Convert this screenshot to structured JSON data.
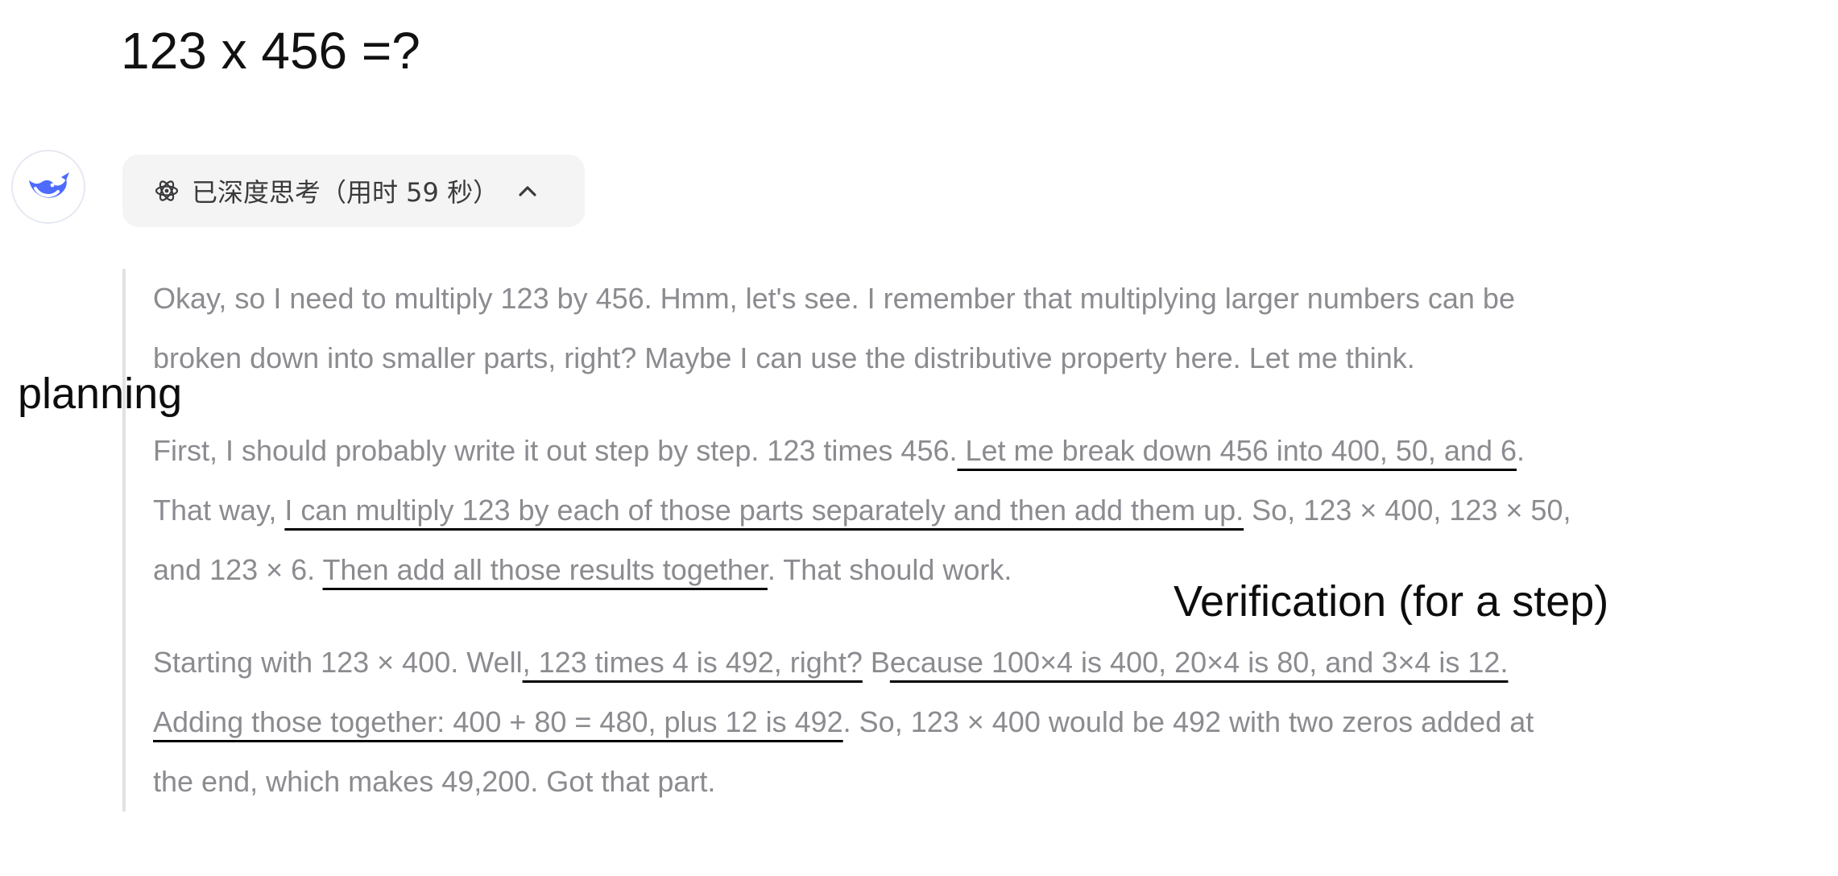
{
  "question": "123 x 456 =?",
  "assistant": {
    "avatar_icon": "deepseek-whale-icon",
    "brand_color": "#4d6bfe"
  },
  "thinking": {
    "icon": "atom-icon",
    "label": "已深度思考（用时 59 秒）",
    "chevron_icon": "chevron-up-icon"
  },
  "reasoning": {
    "p1": {
      "l1": "Okay, so I need to multiply 123 by 456. Hmm, let's see. I remember that multiplying larger numbers can be",
      "l2": "broken down into smaller parts, right? Maybe I can use the distributive property here. Let me think."
    },
    "p2": {
      "l1a": "First, I should probably write it out step by step. 123 times 456.",
      "l1b": " Let me break down 456 into 400, 50, and 6",
      "l1c": ".",
      "l2a": "That way, ",
      "l2b": "I can multiply 123 by each of those parts separately and then add them up.",
      "l2c": " So, 123 × 400, 123 × 50,",
      "l3a": "and 123 × 6. ",
      "l3b": "Then add all those results together",
      "l3c": ". That should work."
    },
    "p3": {
      "l1a": "Starting with 123 × 400. Well",
      "l1b": ", 123 times 4 is 492, right?",
      "l1c": " B",
      "l1d": "ecause 100×4 is 400, 20×4 is 80, and 3×4 is 12.  ",
      "l2a": "Adding those together: 400 + 80 = 480, plus 12 is 492",
      "l2b": ". So, 123 × 400 would be 492 with two zeros added at",
      "l3": "the end, which makes 49,200. Got that part."
    }
  },
  "annotations": {
    "planning": "planning",
    "verification": "Verification (for a step)"
  }
}
